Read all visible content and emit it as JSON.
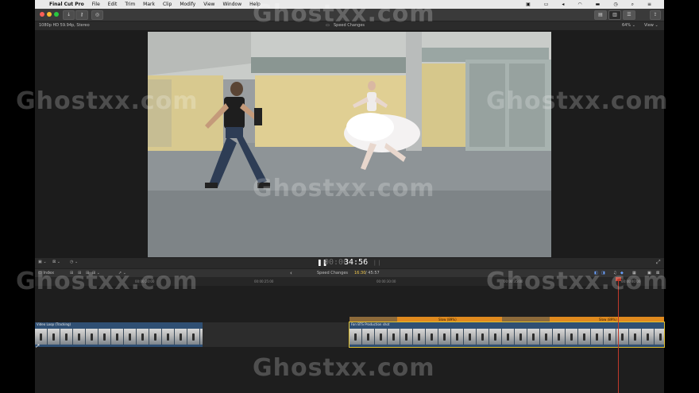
{
  "menubar": {
    "app_name": "Final Cut Pro",
    "items": [
      "File",
      "Edit",
      "Trim",
      "Mark",
      "Clip",
      "Modify",
      "View",
      "Window",
      "Help"
    ]
  },
  "viewer": {
    "format_label": "1080p HD 59.94p, Stereo",
    "title": "Speed Changes",
    "zoom": "64%",
    "view_menu": "View"
  },
  "timecode": {
    "display": "34:56",
    "prefix": "00:00"
  },
  "timeline_header": {
    "index_label": "Index",
    "project_name": "Speed Changes",
    "position": "16:30",
    "duration": "/ 45:57"
  },
  "ruler": {
    "ticks": [
      "00:00:20:00",
      "00:00:25:00",
      "00:00:30:00",
      "00:00:35:00",
      "00:00:40:00"
    ]
  },
  "clips": {
    "left_name": "Video Loop (Tracking)",
    "right_name": "Fan BTS Production shot",
    "speed_label_1": "Slow (89%)",
    "speed_label_2": "Slow (89%)"
  },
  "watermark": "Ghostxx.com",
  "colors": {
    "accent_yellow": "#e0c030",
    "speed_orange": "#e08a1e",
    "clip_blue": "#2f4f73",
    "playhead_red": "#c0392b",
    "timecode_yellow": "#f2c94c"
  }
}
